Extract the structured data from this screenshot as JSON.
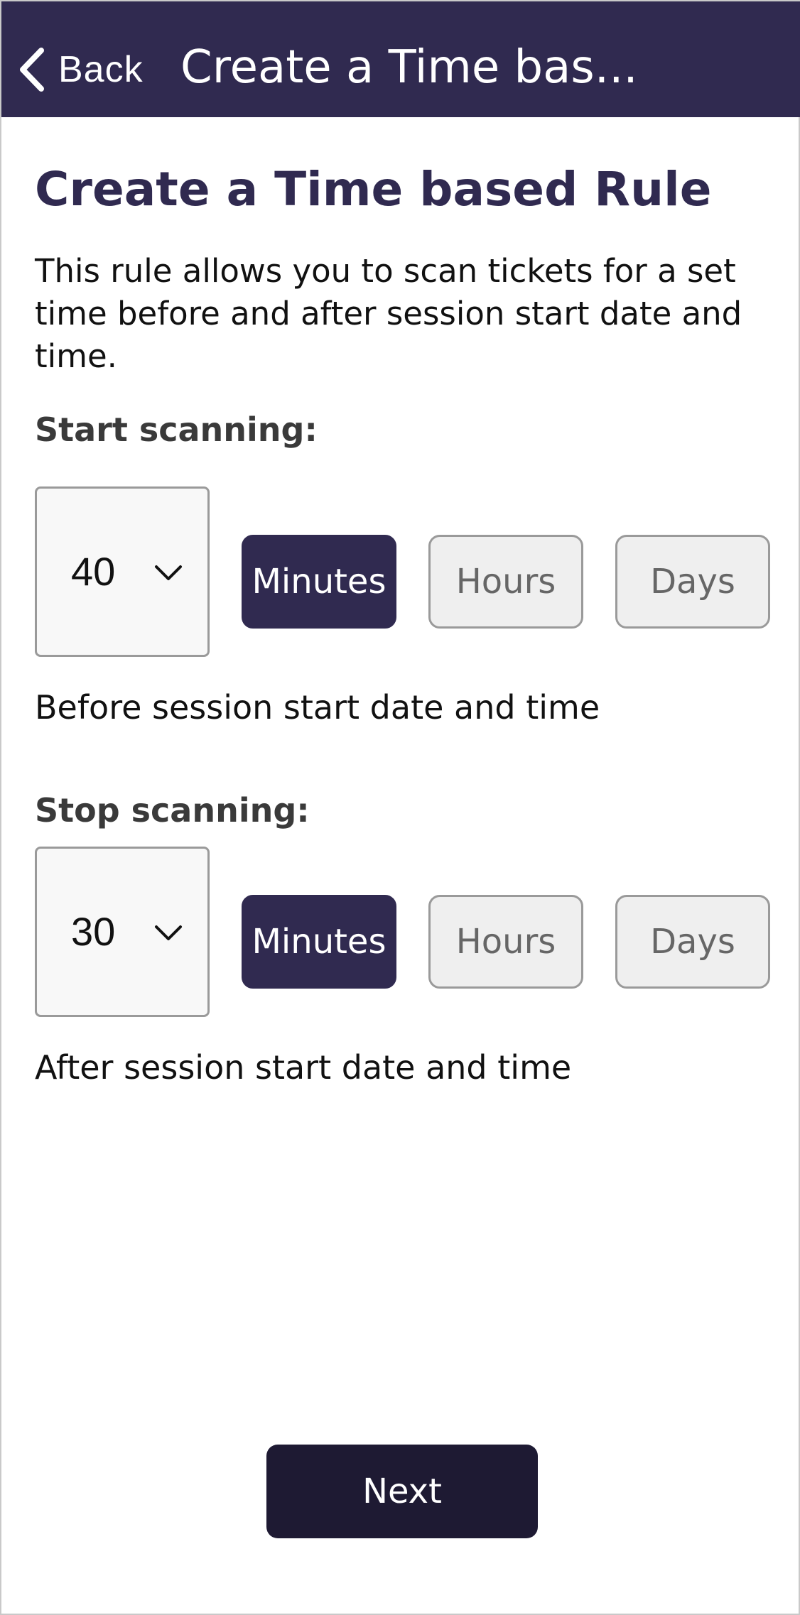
{
  "header": {
    "back_label": "Back",
    "title": "Create a Time bas..."
  },
  "page": {
    "title": "Create a Time based Rule",
    "description": "This rule allows you to scan tickets for a set time before and after session start date and time."
  },
  "start": {
    "label": "Start scanning:",
    "value": "40",
    "units": [
      "Minutes",
      "Hours",
      "Days"
    ],
    "selected_unit": "Minutes",
    "note": "Before session start date and time"
  },
  "stop": {
    "label": "Stop scanning:",
    "value": "30",
    "units": [
      "Minutes",
      "Hours",
      "Days"
    ],
    "selected_unit": "Minutes",
    "note": "After session start date and time"
  },
  "footer": {
    "next_label": "Next"
  },
  "colors": {
    "brand": "#302a50",
    "button_dark": "#1e1a33",
    "unit_inactive_bg": "#efefef"
  }
}
